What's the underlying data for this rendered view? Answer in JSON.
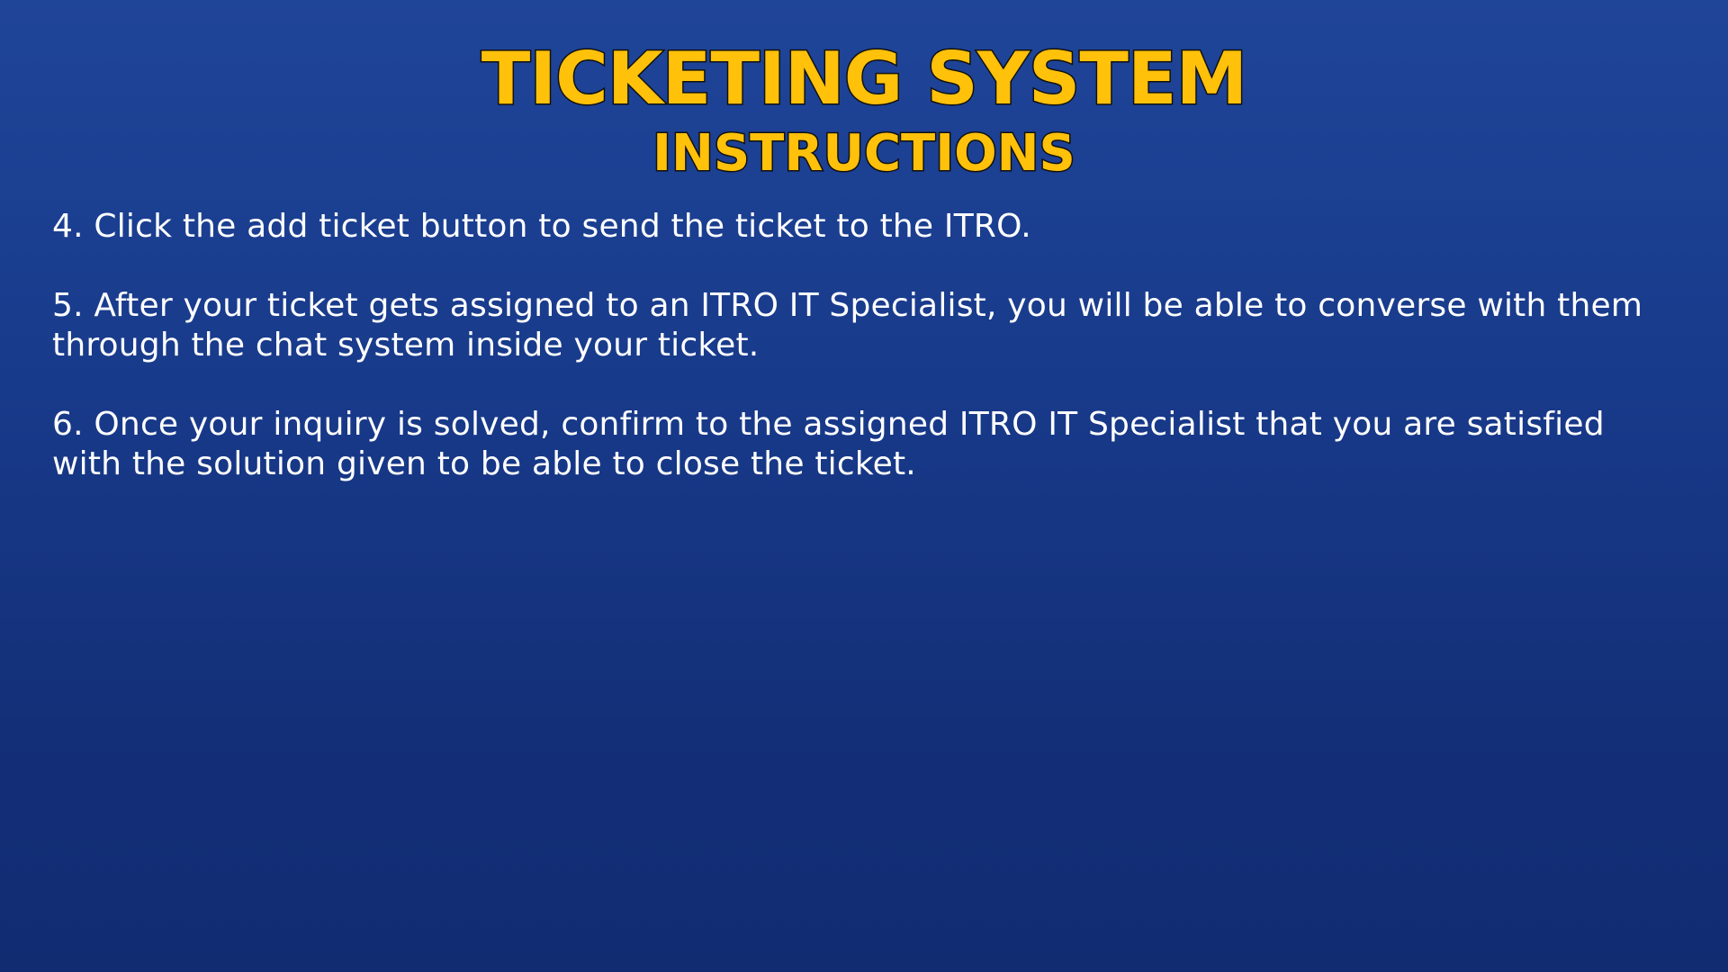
{
  "slide": {
    "title": "TICKETING SYSTEM",
    "subtitle": "INSTRUCTIONS",
    "steps": [
      "4. Click the add ticket button to send the ticket to the ITRO.",
      "5. After your ticket gets assigned to an ITRO IT Specialist, you will be able to converse with them through the chat system inside your ticket.",
      "6. Once your inquiry is solved, confirm to the assigned ITRO IT Specialist that you are satisfied with the solution given to be able to close the ticket."
    ]
  },
  "colors": {
    "background_top": "#1f4599",
    "background_bottom": "#122c72",
    "title": "#ffc10a",
    "title_outline": "#111111",
    "body_text": "#ffffff"
  }
}
